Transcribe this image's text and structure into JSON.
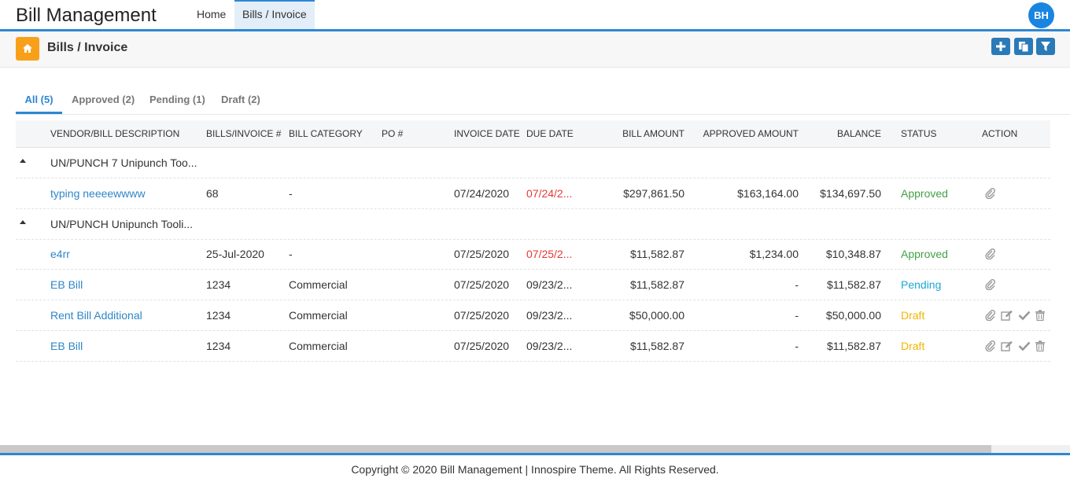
{
  "app": {
    "title": "Bill Management",
    "user_initials": "BH"
  },
  "nav": {
    "home": "Home",
    "bills": "Bills / Invoice"
  },
  "page": {
    "title": "Bills / Invoice"
  },
  "tabs": [
    {
      "label": "All (5)"
    },
    {
      "label": "Approved (2)"
    },
    {
      "label": "Pending (1)"
    },
    {
      "label": "Draft (2)"
    }
  ],
  "table": {
    "columns": [
      "VENDOR/BILL DESCRIPTION",
      "BILLS/INVOICE #",
      "BILL CATEGORY",
      "PO #",
      "INVOICE DATE",
      "DUE DATE",
      "BILL AMOUNT",
      "APPROVED AMOUNT",
      "BALANCE",
      "STATUS",
      "ACTION"
    ],
    "groups": [
      {
        "label": "UN/PUNCH 7 Unipunch Too..."
      },
      {
        "label": "UN/PUNCH Unipunch Tooli..."
      }
    ],
    "rows": [
      {
        "desc": "typing neeeewwww",
        "invoice": "68",
        "category": "-",
        "po": "",
        "invoice_date": "07/24/2020",
        "due_date": "07/24/2...",
        "amount": "$297,861.50",
        "approved": "$163,164.00",
        "balance": "$134,697.50",
        "status": "Approved"
      },
      {
        "desc": "e4rr",
        "invoice": "25-Jul-2020",
        "category": "-",
        "po": "",
        "invoice_date": "07/25/2020",
        "due_date": "07/25/2...",
        "amount": "$11,582.87",
        "approved": "$1,234.00",
        "balance": "$10,348.87",
        "status": "Approved"
      },
      {
        "desc": "EB Bill",
        "invoice": "1234",
        "category": "Commercial",
        "po": "",
        "invoice_date": "07/25/2020",
        "due_date": "09/23/2...",
        "amount": "$11,582.87",
        "approved": "-",
        "balance": "$11,582.87",
        "status": "Pending"
      },
      {
        "desc": "Rent Bill Additional",
        "invoice": "1234",
        "category": "Commercial",
        "po": "",
        "invoice_date": "07/25/2020",
        "due_date": "09/23/2...",
        "amount": "$50,000.00",
        "approved": "-",
        "balance": "$50,000.00",
        "status": "Draft"
      },
      {
        "desc": "EB Bill",
        "invoice": "1234",
        "category": "Commercial",
        "po": "",
        "invoice_date": "07/25/2020",
        "due_date": "09/23/2...",
        "amount": "$11,582.87",
        "approved": "-",
        "balance": "$11,582.87",
        "status": "Draft"
      }
    ]
  },
  "footer": {
    "text": "Copyright © 2020 Bill Management | Innospire Theme. All Rights Reserved."
  },
  "colors": {
    "accent": "#2d87d3",
    "home_badge": "#f9a01b",
    "approved": "#43a047",
    "pending": "#1ba8d6",
    "draft": "#f2b500",
    "overdue": "#e53935"
  },
  "icons": {
    "home": "home-icon",
    "add": "plus-icon",
    "copy": "copy-icon",
    "filter": "filter-icon",
    "attach": "paperclip-icon",
    "edit": "edit-icon",
    "approve": "check-icon",
    "delete": "trash-icon"
  }
}
